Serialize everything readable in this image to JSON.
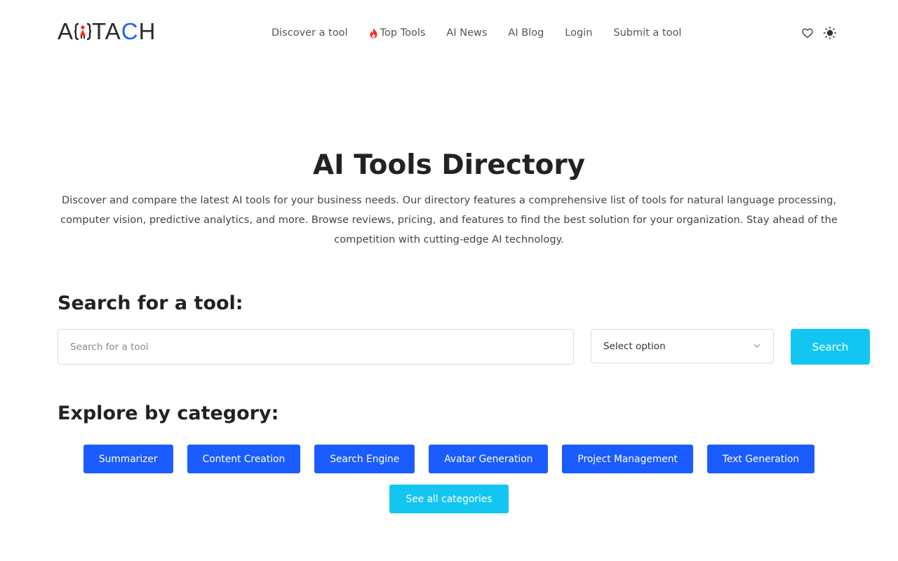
{
  "header": {
    "logo": {
      "left": "A",
      "right_dark": "TA",
      "right_blue": "C",
      "right_end": "H"
    },
    "nav": [
      {
        "label": "Discover a tool"
      },
      {
        "label": "Top Tools",
        "icon": "fire-icon"
      },
      {
        "label": "AI News"
      },
      {
        "label": "AI Blog"
      },
      {
        "label": "Login"
      },
      {
        "label": "Submit a tool"
      }
    ],
    "icons": [
      "heart-icon",
      "sun-icon"
    ]
  },
  "hero": {
    "title": "AI Tools Directory",
    "description": "Discover and compare the latest AI tools for your business needs. Our directory features a comprehensive list of tools for natural language processing, computer vision, predictive analytics, and more. Browse reviews, pricing, and features to find the best solution for your organization. Stay ahead of the competition with cutting-edge AI technology."
  },
  "search": {
    "title": "Search for a tool:",
    "placeholder": "Search for a tool",
    "value": "",
    "select_value": "Select option",
    "button_label": "Search"
  },
  "categories": {
    "title": "Explore by category:",
    "items": [
      {
        "label": "Summarizer"
      },
      {
        "label": "Content Creation"
      },
      {
        "label": "Search Engine"
      },
      {
        "label": "Avatar Generation"
      },
      {
        "label": "Project Management"
      },
      {
        "label": "Text Generation"
      }
    ],
    "see_all_label": "See all categories"
  },
  "colors": {
    "primary_blue": "#1a5cff",
    "accent_cyan": "#13c6f2",
    "fire_red": "#ff2a1a",
    "logo_blue": "#1e63ff"
  }
}
